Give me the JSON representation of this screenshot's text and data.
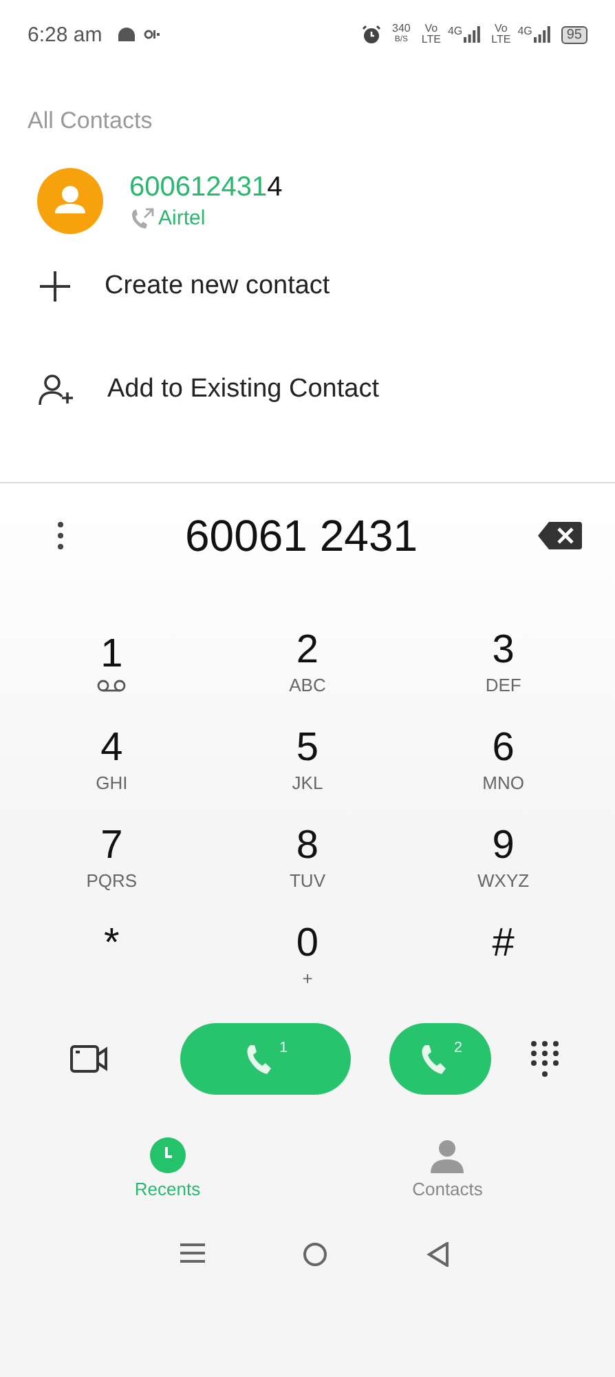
{
  "status_bar": {
    "time": "6:28 am",
    "speed": "340",
    "speed_unit": "B/S",
    "sim1": {
      "vo": "Vo",
      "lte": "LTE",
      "net": "4G"
    },
    "sim2": {
      "vo": "Vo",
      "lte": "LTE",
      "net": "4G"
    },
    "battery": "95"
  },
  "section_title": "All Contacts",
  "suggestion": {
    "number_match": "600612431",
    "number_rest": "4",
    "carrier": "Airtel"
  },
  "actions": [
    {
      "kind": "create",
      "label": "Create new contact"
    },
    {
      "kind": "add",
      "label": "Add to Existing Contact"
    }
  ],
  "dialer": {
    "number": "60061 2431"
  },
  "keys": [
    {
      "digit": "1",
      "kind": "voicemail"
    },
    {
      "digit": "2",
      "sub": "ABC",
      "kind": "text"
    },
    {
      "digit": "3",
      "sub": "DEF",
      "kind": "text"
    },
    {
      "digit": "4",
      "sub": "GHI",
      "kind": "text"
    },
    {
      "digit": "5",
      "sub": "JKL",
      "kind": "text"
    },
    {
      "digit": "6",
      "sub": "MNO",
      "kind": "text"
    },
    {
      "digit": "7",
      "sub": "PQRS",
      "kind": "text"
    },
    {
      "digit": "8",
      "sub": "TUV",
      "kind": "text"
    },
    {
      "digit": "9",
      "sub": "WXYZ",
      "kind": "text"
    },
    {
      "digit": "*",
      "kind": "text"
    },
    {
      "digit": "0",
      "sub": "+",
      "kind": "text"
    },
    {
      "digit": "#",
      "kind": "text"
    }
  ],
  "call_buttons": [
    {
      "sim": "1",
      "wide": true
    },
    {
      "sim": "2",
      "wide": false
    }
  ],
  "tabs": [
    {
      "label": "Recents",
      "kind": "recents",
      "selected": true
    },
    {
      "label": "Contacts",
      "kind": "contacts",
      "selected": false
    }
  ]
}
